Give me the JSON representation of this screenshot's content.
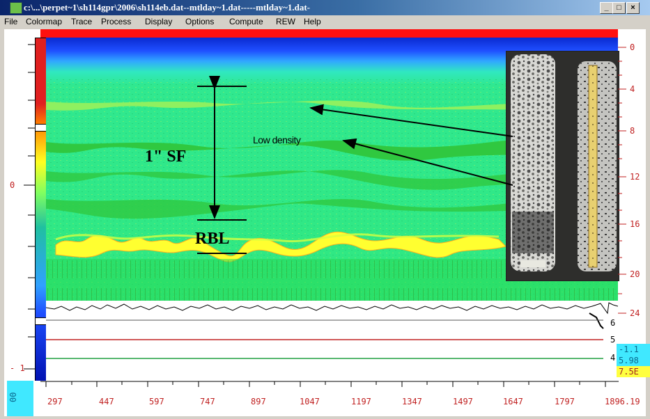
{
  "window": {
    "title": "c:\\...\\perpet~1\\sh114gpr\\2006\\sh114eb.dat--mtlday~1.dat-----mtlday~1.dat-",
    "minimize_label": "_",
    "maximize_label": "□",
    "close_label": "×"
  },
  "menu": [
    "File",
    "Colormap",
    "Trace",
    "Process",
    "Display",
    "Options",
    "Compute",
    "REW",
    "Help"
  ],
  "left_axis": {
    "zero_label": "0",
    "minus_one_label": "- 1"
  },
  "right_axis_ticks": [
    "0",
    "4",
    "8",
    "12",
    "16",
    "20",
    "24"
  ],
  "right_lower_labels": [
    "6",
    "5",
    "4"
  ],
  "right_value_boxes": [
    {
      "text": "-1.1",
      "bg": "#40e8ff",
      "color": "#0a6a90"
    },
    {
      "text": "5.98",
      "bg": "#40e8ff",
      "color": "#0a6a90"
    },
    {
      "text": "7.5E",
      "bg": "#ffff40",
      "color": "#a02020"
    }
  ],
  "bottom_axis": {
    "corner_label": "00",
    "ticks": [
      "297",
      "447",
      "597",
      "747",
      "897",
      "1047",
      "1197",
      "1347",
      "1497",
      "1647",
      "1797",
      "1896.19"
    ]
  },
  "annotations": {
    "sf_label": "1\" SF",
    "rbl_label": "RBL",
    "low_density_label": "Low density"
  },
  "colors": {
    "title_bar": "#0a246a",
    "scan_green": "#22e060",
    "scan_cyan": "#30e8c0",
    "scan_blue": "#1f4fff",
    "scan_yellow": "#ffff30",
    "trace_red": "#c02020",
    "trace_green": "#20a040"
  }
}
